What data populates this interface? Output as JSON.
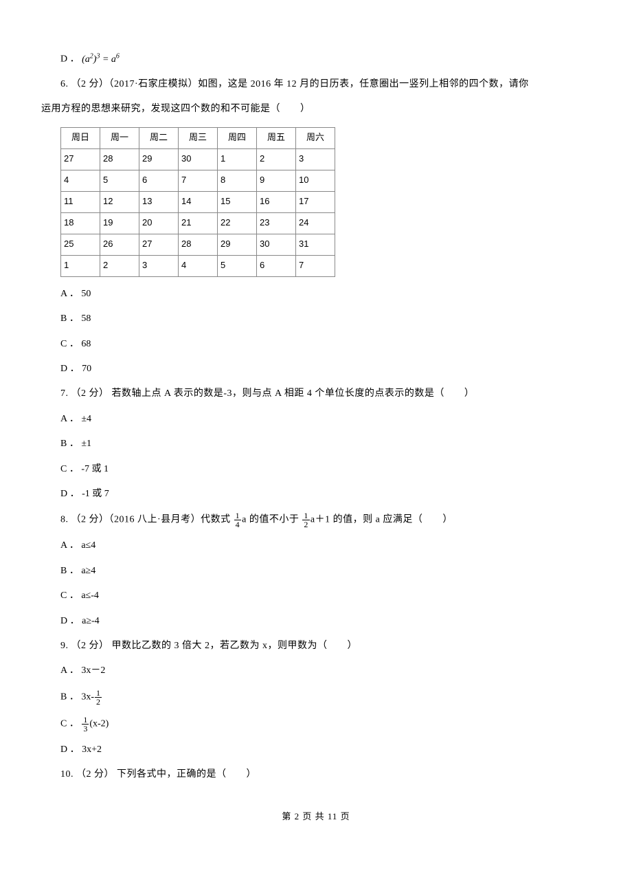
{
  "q5": {
    "optD_prefix": "D ．",
    "optD_formula_html": "(<i>a</i><sup>2</sup>)<sup>3</sup> = <i>a</i><sup>6</sup>"
  },
  "q6": {
    "stem_part1": "6. （2 分）（2017·石家庄模拟）如图，这是 2016 年 12 月的日历表，任意圈出一竖列上相邻的四个数，请你",
    "stem_part2": "运用方程的思想来研究，发现这四个数的和不可能是（　　）",
    "calendar": {
      "headers": [
        "周日",
        "周一",
        "周二",
        "周三",
        "周四",
        "周五",
        "周六"
      ],
      "rows": [
        [
          "27",
          "28",
          "29",
          "30",
          "1",
          "2",
          "3"
        ],
        [
          "4",
          "5",
          "6",
          "7",
          "8",
          "9",
          "10"
        ],
        [
          "11",
          "12",
          "13",
          "14",
          "15",
          "16",
          "17"
        ],
        [
          "18",
          "19",
          "20",
          "21",
          "22",
          "23",
          "24"
        ],
        [
          "25",
          "26",
          "27",
          "28",
          "29",
          "30",
          "31"
        ],
        [
          "1",
          "2",
          "3",
          "4",
          "5",
          "6",
          "7"
        ]
      ]
    },
    "optA": "A ． 50",
    "optB": "B ． 58",
    "optC": "C ． 68",
    "optD": "D ． 70"
  },
  "q7": {
    "stem": "7. （2 分） 若数轴上点 A 表示的数是-3，则与点 A 相距 4 个单位长度的点表示的数是（　　）",
    "optA": "A ． ±4",
    "optB": "B ． ±1",
    "optC": "C ． -7 或 1",
    "optD": "D ． -1 或 7"
  },
  "q8": {
    "stem_prefix": "8. （2 分）（2016 八上·县月考）代数式 ",
    "frac1_n": "1",
    "frac1_d": "4",
    "stem_mid1": "a",
    "stem_mid2": " 的值不小于 ",
    "frac2_n": "1",
    "frac2_d": "2",
    "stem_mid3": "a＋1",
    "stem_suffix": " 的值，则 a 应满足（　　）",
    "optA": "A ． a≤4",
    "optB": "B ． a≥4",
    "optC": "C ． a≤-4",
    "optD": "D ． a≥-4"
  },
  "q9": {
    "stem": "9. （2 分） 甲数比乙数的 3 倍大 2，若乙数为 x，则甲数为（　　）",
    "optA": "A ． 3x－2",
    "optB_prefix": "B ． 3x-",
    "optB_frac_n": "1",
    "optB_frac_d": "2",
    "optC_prefix": "C ． ",
    "optC_frac_n": "1",
    "optC_frac_d": "3",
    "optC_suffix": "(x-2)",
    "optD": "D ． 3x+2"
  },
  "q10": {
    "stem": "10. （2 分） 下列各式中，正确的是（　　）"
  },
  "footer": "第 2 页 共 11 页"
}
